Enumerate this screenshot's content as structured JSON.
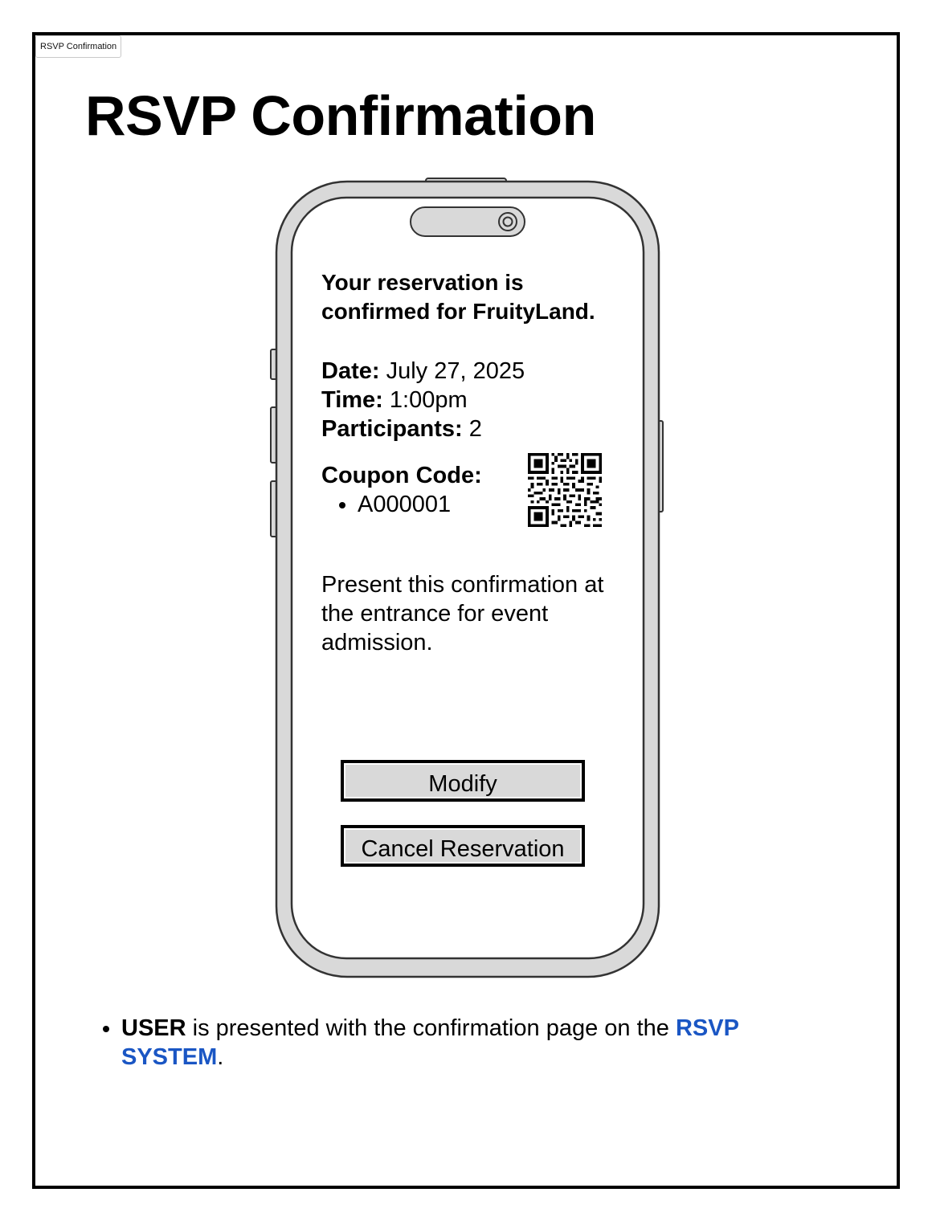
{
  "tab": {
    "label": "RSVP Confirmation"
  },
  "page": {
    "title": "RSVP Confirmation"
  },
  "phone": {
    "confirmation_message": "Your reservation is confirmed for FruityLand.",
    "date_label": "Date:",
    "date_value": "July 27, 2025",
    "time_label": "Time:",
    "time_value": "1:00pm",
    "participants_label": "Participants:",
    "participants_value": "2",
    "coupon_label": "Coupon Code:",
    "coupon_codes": [
      "A000001"
    ],
    "instructions": "Present this confirmation at the entrance for event admission.",
    "modify_button": "Modify",
    "cancel_button": "Cancel Reservation"
  },
  "notes": {
    "actor": "USER",
    "text": " is presented with the confirmation page on the ",
    "system": "RSVP SYSTEM",
    "end": "."
  },
  "colors": {
    "link": "#1a56c4",
    "phone_body": "#d9d9d9",
    "button_fill": "#d9d9d9"
  }
}
